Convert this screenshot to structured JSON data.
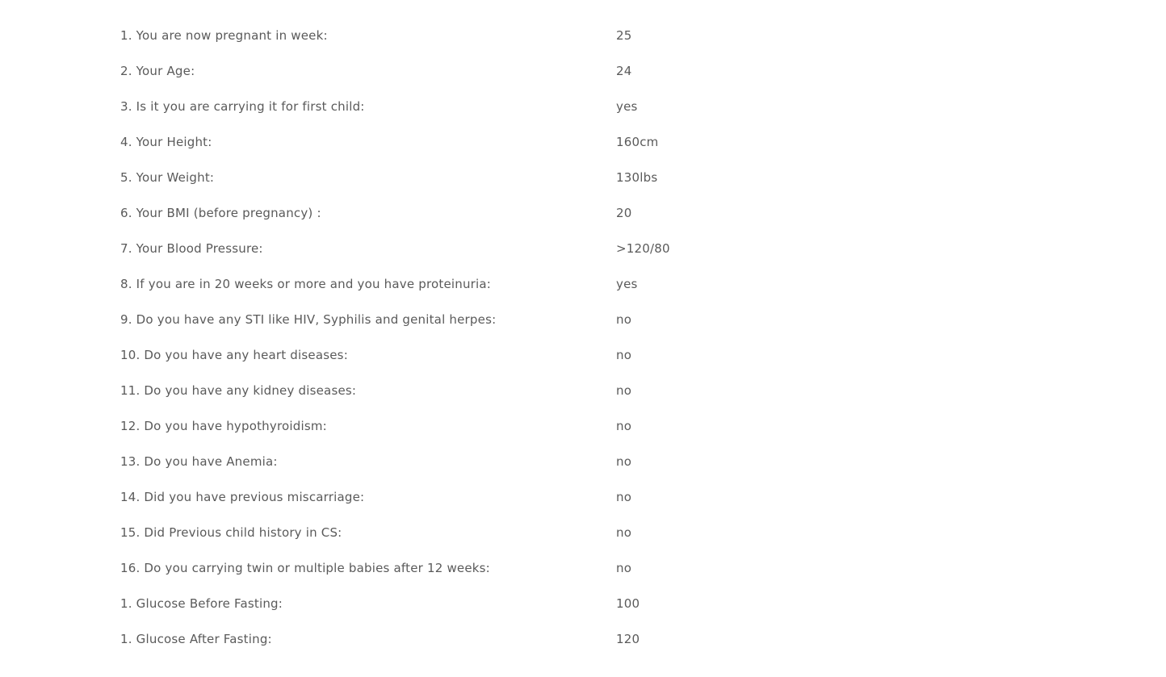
{
  "rows": [
    {
      "question": "1. You are now pregnant in week:",
      "answer": "25"
    },
    {
      "question": "2. Your Age:",
      "answer": "24"
    },
    {
      "question": "3. Is it you are carrying it for first child:",
      "answer": "yes"
    },
    {
      "question": "4. Your Height:",
      "answer": "160cm"
    },
    {
      "question": "5. Your Weight:",
      "answer": "130lbs"
    },
    {
      "question": "6. Your BMI (before pregnancy) :",
      "answer": "20"
    },
    {
      "question": "7. Your Blood Pressure:",
      "answer": ">120/80"
    },
    {
      "question": "8. If you are in 20 weeks or more and you have proteinuria:",
      "answer": "yes"
    },
    {
      "question": "9. Do you have any STI like HIV, Syphilis and genital herpes:",
      "answer": "no"
    },
    {
      "question": "10. Do you have any heart diseases:",
      "answer": "no"
    },
    {
      "question": "11. Do you have any kidney diseases:",
      "answer": "no"
    },
    {
      "question": "12. Do you have hypothyroidism:",
      "answer": "no"
    },
    {
      "question": "13. Do you have Anemia:",
      "answer": "no"
    },
    {
      "question": "14. Did you have previous miscarriage:",
      "answer": "no"
    },
    {
      "question": "15. Did Previous child history in CS:",
      "answer": "no"
    },
    {
      "question": "16. Do you carrying twin or multiple babies after 12 weeks:",
      "answer": "no"
    },
    {
      "question": "1. Glucose Before Fasting:",
      "answer": "100"
    },
    {
      "question": "1. Glucose After Fasting:",
      "answer": "120"
    }
  ]
}
